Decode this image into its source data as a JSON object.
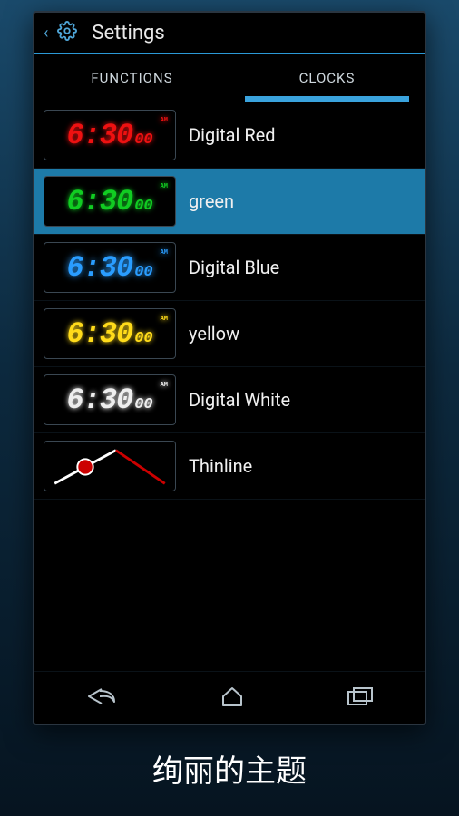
{
  "header": {
    "title": "Settings"
  },
  "tabs": {
    "functions": "FUNCTIONS",
    "clocks": "CLOCKS",
    "active": "clocks"
  },
  "clock_time": {
    "main": "6:30",
    "sec": "00",
    "ampm": "AM"
  },
  "themes": [
    {
      "id": "digital-red",
      "label": "Digital Red",
      "color": "#ee1111"
    },
    {
      "id": "green",
      "label": "green",
      "color": "#11cc22",
      "selected": true
    },
    {
      "id": "digital-blue",
      "label": "Digital Blue",
      "color": "#2a9dff"
    },
    {
      "id": "yellow",
      "label": "yellow",
      "color": "#ffdb1a"
    },
    {
      "id": "digital-white",
      "label": "Digital White",
      "color": "#eeeeee"
    },
    {
      "id": "thinline",
      "label": "Thinline",
      "style": "analog"
    }
  ],
  "caption": "绚丽的主题"
}
